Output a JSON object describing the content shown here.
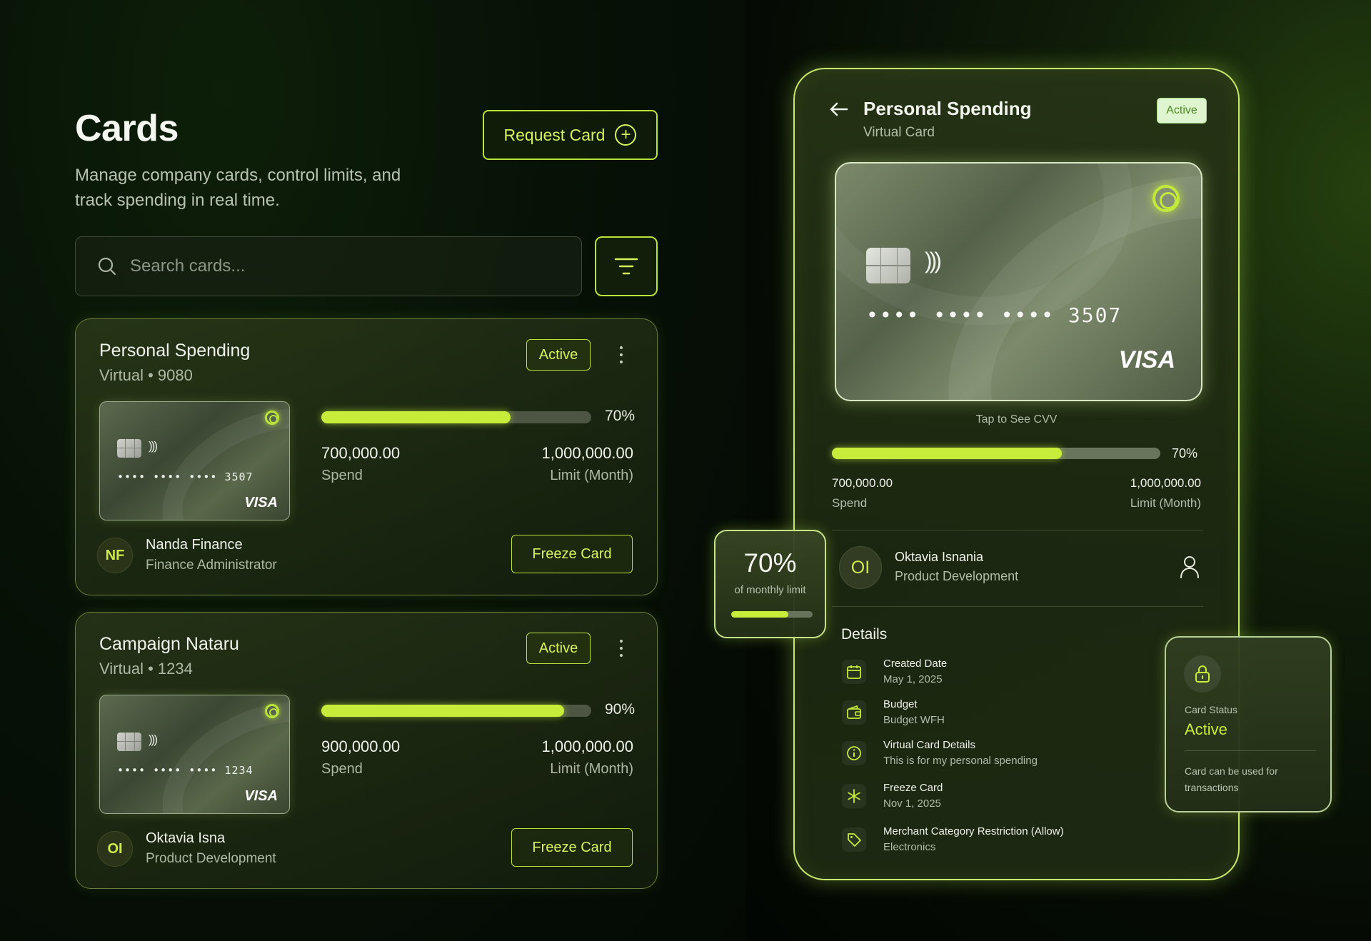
{
  "page": {
    "title": "Cards",
    "subtitle": "Manage company cards, control limits, and track spending in real time.",
    "request_button": "Request Card",
    "search": {
      "placeholder": "Search cards..."
    }
  },
  "cards": [
    {
      "name": "Personal Spending",
      "type_number": "Virtual • 9080",
      "status": "Active",
      "masked_number": "•••• •••• ••••  3507",
      "brand": "VISA",
      "progress_percent": 70,
      "progress_label": "70%",
      "spend": "700,000.00",
      "spend_label": "Spend",
      "limit": "1,000,000.00",
      "limit_label": "Limit (Month)",
      "owner_initials": "NF",
      "owner_name": "Nanda Finance",
      "owner_role": "Finance Administrator",
      "freeze_label": "Freeze Card"
    },
    {
      "name": "Campaign Nataru",
      "type_number": "Virtual • 1234",
      "status": "Active",
      "masked_number": "•••• •••• ••••  1234",
      "brand": "VISA",
      "progress_percent": 90,
      "progress_label": "90%",
      "spend": "900,000.00",
      "spend_label": "Spend",
      "limit": "1,000,000.00",
      "limit_label": "Limit (Month)",
      "owner_initials": "OI",
      "owner_name": "Oktavia Isna",
      "owner_role": "Product Development",
      "freeze_label": "Freeze Card"
    }
  ],
  "detail": {
    "title": "Personal Spending",
    "subtitle": "Virtual Card",
    "status": "Active",
    "masked_number": "•••• •••• ••••  3507",
    "brand": "VISA",
    "cvv_hint": "Tap to See CVV",
    "progress_percent": 70,
    "progress_label": "70%",
    "spend": "700,000.00",
    "spend_label": "Spend",
    "limit": "1,000,000.00",
    "limit_label": "Limit (Month)",
    "owner_initials": "OI",
    "owner_name": "Oktavia Isnania",
    "owner_role": "Product Development",
    "details_title": "Details",
    "details": [
      {
        "icon": "calendar-icon",
        "label": "Created Date",
        "value": "May 1, 2025"
      },
      {
        "icon": "wallet-icon",
        "label": "Budget",
        "value": "Budget WFH"
      },
      {
        "icon": "info-icon",
        "label": "Virtual Card Details",
        "value": "This is for my personal spending"
      },
      {
        "icon": "snowflake-icon",
        "label": "Freeze Card",
        "value": "Nov 1, 2025"
      },
      {
        "icon": "tag-icon",
        "label": "Merchant Category Restriction (Allow)",
        "value": "Electronics"
      }
    ]
  },
  "monthly_widget": {
    "value": "70%",
    "label": "of monthly limit",
    "progress_percent": 70
  },
  "status_widget": {
    "label": "Card Status",
    "value": "Active",
    "note": "Card can be used for transactions"
  },
  "colors": {
    "accent": "#c7ec3a",
    "accent_text": "#d7f261",
    "background": "#040904",
    "active_badge_bg": "#dff5d0",
    "active_badge_text": "#4a8b1e"
  }
}
